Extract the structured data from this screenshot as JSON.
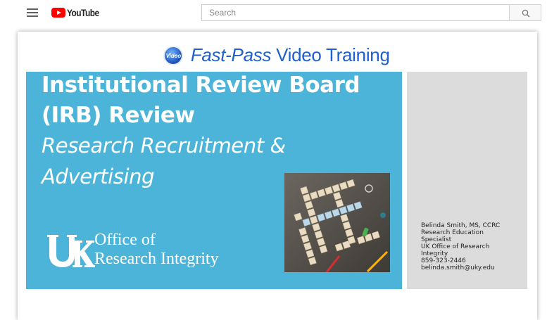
{
  "header": {
    "logo_text": "YouTube",
    "search_placeholder": "Search",
    "icons": [
      "menu-icon",
      "youtube-logo-icon",
      "search-icon"
    ]
  },
  "slide": {
    "brand": {
      "badge_text": "Video",
      "title_bold": "Fast-Pass",
      "title_rest": " Video Training"
    },
    "title_lines": [
      "Institutional Review Board",
      "(IRB) Review",
      "Research Recruitment &",
      "Advertising"
    ],
    "office": {
      "line1": "Office of",
      "line2": "Research Integrity",
      "logo_letters": "UK"
    },
    "tiles": {
      "words": [
        "PRODUCT",
        "RESEARCH",
        "STRATEGY",
        "MARKETING",
        "LISTING",
        "BRANDING"
      ]
    },
    "contact": [
      "Belinda Smith, MS, CCRC",
      "Research Education",
      "Specialist",
      "UK Office of Research",
      "Integrity",
      "859-323-2446",
      "belinda.smith@uky.edu"
    ]
  },
  "colors": {
    "panel_blue": "#4cb4d8",
    "panel_gray": "#dcdcdc",
    "brand_blue": "#1f5fcf",
    "youtube_red": "#ff0000"
  }
}
